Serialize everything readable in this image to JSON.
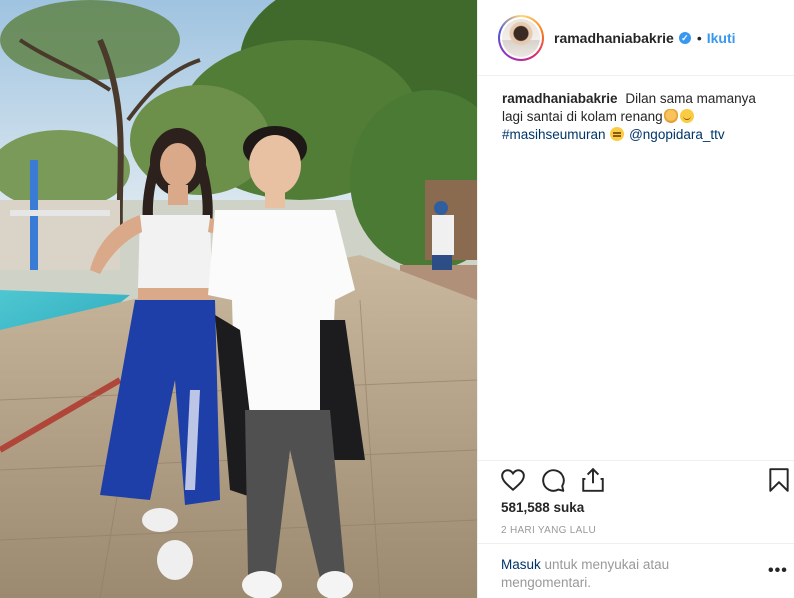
{
  "post": {
    "username": "ramadhaniabakrie",
    "verified_mark": "✓",
    "separator": "•",
    "follow_label": "Ikuti",
    "caption": {
      "username": "ramadhaniabakrie",
      "text": "Dilan sama mamanya lagi santai di kolam renang",
      "hashtag": "#masihseumuran",
      "mention": "@ngopidara_ttv",
      "emojis": [
        "hand-emoji",
        "smile-emoji",
        "expressionless-emoji"
      ]
    },
    "likes": "581,588 suka",
    "timestamp": "2 HARI YANG LALU",
    "login_link": "Masuk",
    "login_text": " untuk menyukai atau mengomentari.",
    "more_label": "•••"
  },
  "icons": {
    "like": "heart-icon",
    "comment": "comment-icon",
    "share": "share-icon",
    "save": "bookmark-icon",
    "verified": "verified-badge-icon",
    "options": "more-options-icon"
  },
  "colors": {
    "accent_link": "#3897f0",
    "text": "#262626",
    "muted": "#999999",
    "tag": "#003569",
    "border": "#efefef"
  }
}
